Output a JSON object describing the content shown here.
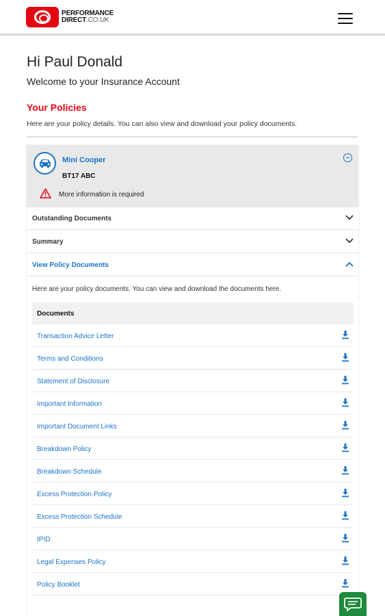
{
  "header": {
    "logo_line1": "PERFORMANCE",
    "logo_line2": "DIRECT",
    "logo_domain": ".CO.UK",
    "menu_icon": "hamburger-menu-icon"
  },
  "greeting": "Hi Paul Donald",
  "welcome": "Welcome to your Insurance Account",
  "policies": {
    "title": "Your Policies",
    "description": "Here are your policy details. You can also view and download your policy documents."
  },
  "policy": {
    "vehicle_name": "Mini Cooper",
    "registration": "BT17 ABC",
    "warning": "More information is required",
    "icons": {
      "vehicle": "car-icon",
      "collapse": "minus-circle-icon",
      "warning": "warning-triangle-icon"
    }
  },
  "sections": {
    "outstanding": "Outstanding Documents",
    "summary": "Summary",
    "view_docs": "View Policy Documents"
  },
  "documents": {
    "intro": "Here are your policy documents. You can view and download the documents here.",
    "header": "Documents",
    "items": [
      "Transaction Advice Letter",
      "Terms and Conditions",
      "Statement of Disclosure",
      "Important Information",
      "Important Document Links",
      "Breakdown Policy",
      "Breakdown Schedule",
      "Excess Protection Policy",
      "Excess Protection Schedule",
      "IPID",
      "Legal Expenses Policy",
      "Policy Booklet"
    ]
  },
  "colors": {
    "brand_red": "#e30613",
    "link_blue": "#1a73c8",
    "chat_green": "#1e8a3c"
  },
  "chat_icon": "chat-bubble-icon"
}
